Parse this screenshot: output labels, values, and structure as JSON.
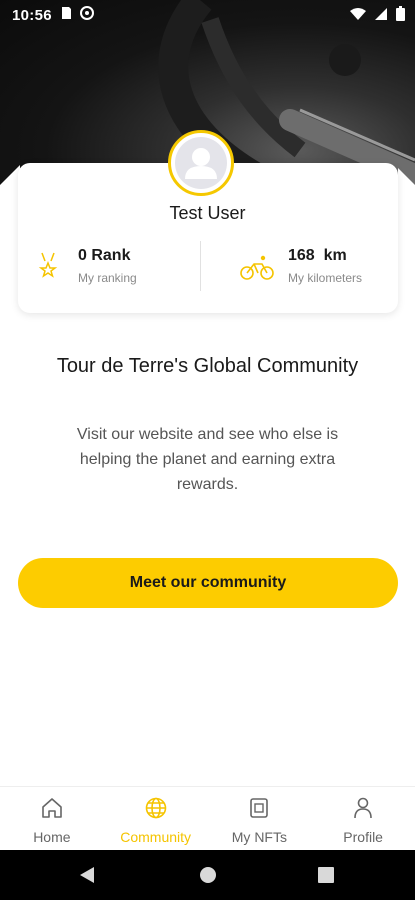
{
  "status_bar": {
    "time": "10:56"
  },
  "profile": {
    "name": "Test User",
    "ranking": {
      "value": "0 Rank",
      "label": "My ranking"
    },
    "kilometers": {
      "value": "168  km",
      "label": "My kilometers"
    }
  },
  "community": {
    "title": "Tour de Terre's Global Community",
    "description": "Visit our website and see who else is helping the planet and earning extra rewards.",
    "cta_label": "Meet our community"
  },
  "bottom_nav": {
    "items": [
      {
        "label": "Home",
        "icon": "home-icon",
        "active": false
      },
      {
        "label": "Community",
        "icon": "globe-icon",
        "active": true
      },
      {
        "label": "My NFTs",
        "icon": "nft-icon",
        "active": false
      },
      {
        "label": "Profile",
        "icon": "person-icon",
        "active": false
      }
    ]
  },
  "colors": {
    "accent": "#fdcc00",
    "text": "#1a1a1a",
    "muted": "#8a8a8a"
  }
}
